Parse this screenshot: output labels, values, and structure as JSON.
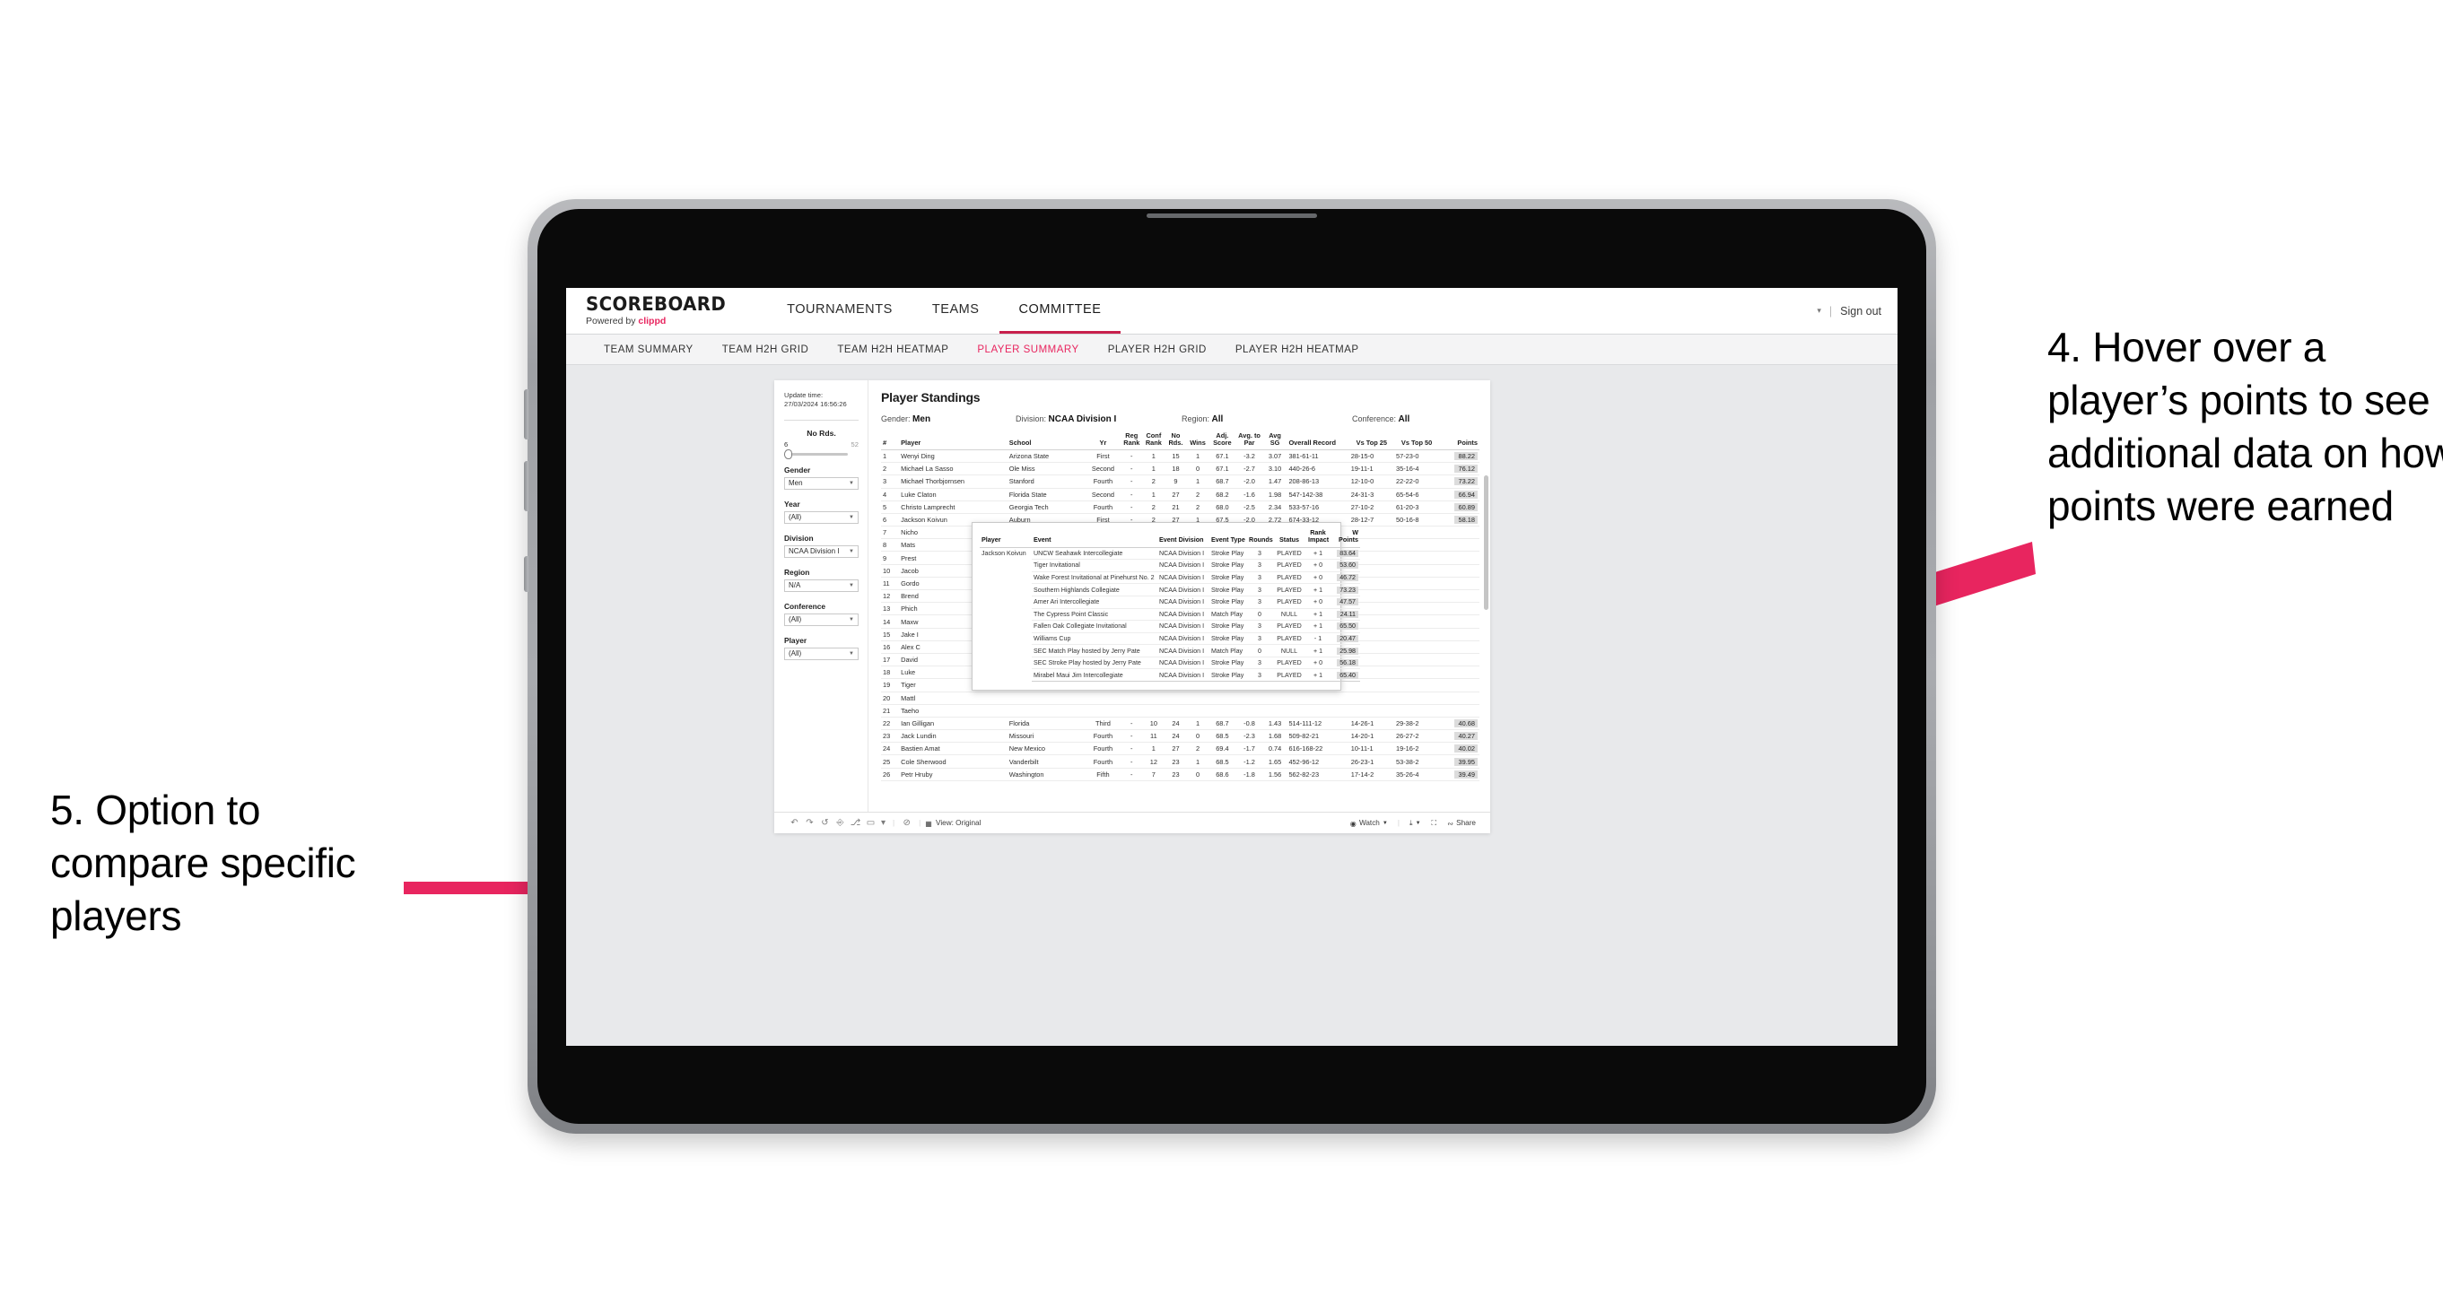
{
  "annotations": {
    "right": "4. Hover over a player’s points to see additional data on how points were earned",
    "left": "5. Option to compare specific players",
    "arrow_color": "#E8255F"
  },
  "app": {
    "brand": {
      "title": "SCOREBOARD",
      "sub_prefix": "Powered by ",
      "sub_brand": "clippd"
    },
    "top_nav": [
      {
        "label": "TOURNAMENTS",
        "active": false
      },
      {
        "label": "TEAMS",
        "active": false
      },
      {
        "label": "COMMITTEE",
        "active": true
      }
    ],
    "top_right": {
      "caret": "▾",
      "divider": "|",
      "sign_out": "Sign out"
    },
    "sub_nav": [
      {
        "label": "TEAM SUMMARY",
        "active": false
      },
      {
        "label": "TEAM H2H GRID",
        "active": false
      },
      {
        "label": "TEAM H2H HEATMAP",
        "active": false
      },
      {
        "label": "PLAYER SUMMARY",
        "active": true
      },
      {
        "label": "PLAYER H2H GRID",
        "active": false
      },
      {
        "label": "PLAYER H2H HEATMAP",
        "active": false
      }
    ]
  },
  "filters": {
    "update_label": "Update time:",
    "update_value": "27/03/2024 16:56:26",
    "slider": {
      "title": "No Rds.",
      "min": "6",
      "max": "52",
      "value": 6
    },
    "selects": [
      {
        "label": "Gender",
        "value": "Men"
      },
      {
        "label": "Year",
        "value": "(All)"
      },
      {
        "label": "Division",
        "value": "NCAA Division I"
      },
      {
        "label": "Region",
        "value": "N/A"
      },
      {
        "label": "Conference",
        "value": "(All)"
      },
      {
        "label": "Player",
        "value": "(All)"
      }
    ]
  },
  "viz": {
    "title": "Player Standings",
    "meta": [
      {
        "label": "Gender:",
        "value": "Men"
      },
      {
        "label": "Division:",
        "value": "NCAA Division I"
      },
      {
        "label": "Region:",
        "value": "All"
      },
      {
        "label": "Conference:",
        "value": "All"
      }
    ],
    "columns": [
      "#",
      "Player",
      "School",
      "Yr",
      "Reg Rank",
      "Conf Rank",
      "No Rds.",
      "Wins",
      "Adj. Score",
      "Avg. to Par",
      "Avg SG",
      "Overall Record",
      "Vs Top 25",
      "Vs Top 50",
      "Points"
    ],
    "rows": [
      [
        "1",
        "Wenyi Ding",
        "Arizona State",
        "First",
        "-",
        "1",
        "15",
        "1",
        "67.1",
        "-3.2",
        "3.07",
        "381-61-11",
        "28-15-0",
        "57-23-0",
        "88.22"
      ],
      [
        "2",
        "Michael La Sasso",
        "Ole Miss",
        "Second",
        "-",
        "1",
        "18",
        "0",
        "67.1",
        "-2.7",
        "3.10",
        "440-26-6",
        "19-11-1",
        "35-16-4",
        "76.12"
      ],
      [
        "3",
        "Michael Thorbjornsen",
        "Stanford",
        "Fourth",
        "-",
        "2",
        "9",
        "1",
        "68.7",
        "-2.0",
        "1.47",
        "208-86-13",
        "12-10-0",
        "22-22-0",
        "73.22"
      ],
      [
        "4",
        "Luke Claton",
        "Florida State",
        "Second",
        "-",
        "1",
        "27",
        "2",
        "68.2",
        "-1.6",
        "1.98",
        "547-142-38",
        "24-31-3",
        "65-54-6",
        "66.94"
      ],
      [
        "5",
        "Christo Lamprecht",
        "Georgia Tech",
        "Fourth",
        "-",
        "2",
        "21",
        "2",
        "68.0",
        "-2.5",
        "2.34",
        "533-57-16",
        "27-10-2",
        "61-20-3",
        "60.89"
      ],
      [
        "6",
        "Jackson Koivun",
        "Auburn",
        "First",
        "-",
        "2",
        "27",
        "1",
        "67.5",
        "-2.0",
        "2.72",
        "674-33-12",
        "28-12-7",
        "50-16-8",
        "58.18"
      ],
      [
        "7",
        "Nicho",
        "",
        "",
        "",
        "",
        "",
        "",
        "",
        "",
        "",
        "",
        "",
        "",
        ""
      ],
      [
        "8",
        "Mats",
        "",
        "",
        "",
        "",
        "",
        "",
        "",
        "",
        "",
        "",
        "",
        "",
        ""
      ],
      [
        "9",
        "Prest",
        "",
        "",
        "",
        "",
        "",
        "",
        "",
        "",
        "",
        "",
        "",
        "",
        ""
      ],
      [
        "10",
        "Jacob",
        "",
        "",
        "",
        "",
        "",
        "",
        "",
        "",
        "",
        "",
        "",
        "",
        ""
      ],
      [
        "11",
        "Gordo",
        "",
        "",
        "",
        "",
        "",
        "",
        "",
        "",
        "",
        "",
        "",
        "",
        ""
      ],
      [
        "12",
        "Brend",
        "",
        "",
        "",
        "",
        "",
        "",
        "",
        "",
        "",
        "",
        "",
        "",
        ""
      ],
      [
        "13",
        "Phich",
        "",
        "",
        "",
        "",
        "",
        "",
        "",
        "",
        "",
        "",
        "",
        "",
        ""
      ],
      [
        "14",
        "Maxw",
        "",
        "",
        "",
        "",
        "",
        "",
        "",
        "",
        "",
        "",
        "",
        "",
        ""
      ],
      [
        "15",
        "Jake I",
        "",
        "",
        "",
        "",
        "",
        "",
        "",
        "",
        "",
        "",
        "",
        "",
        ""
      ],
      [
        "16",
        "Alex C",
        "",
        "",
        "",
        "",
        "",
        "",
        "",
        "",
        "",
        "",
        "",
        "",
        ""
      ],
      [
        "17",
        "David",
        "",
        "",
        "",
        "",
        "",
        "",
        "",
        "",
        "",
        "",
        "",
        "",
        ""
      ],
      [
        "18",
        "Luke",
        "",
        "",
        "",
        "",
        "",
        "",
        "",
        "",
        "",
        "",
        "",
        "",
        ""
      ],
      [
        "19",
        "Tiger",
        "",
        "",
        "",
        "",
        "",
        "",
        "",
        "",
        "",
        "",
        "",
        "",
        ""
      ],
      [
        "20",
        "Mattl",
        "",
        "",
        "",
        "",
        "",
        "",
        "",
        "",
        "",
        "",
        "",
        "",
        ""
      ],
      [
        "21",
        "Taeho",
        "",
        "",
        "",
        "",
        "",
        "",
        "",
        "",
        "",
        "",
        "",
        "",
        ""
      ],
      [
        "22",
        "Ian Gilligan",
        "Florida",
        "Third",
        "-",
        "10",
        "24",
        "1",
        "68.7",
        "-0.8",
        "1.43",
        "514-111-12",
        "14-26-1",
        "29-38-2",
        "40.68"
      ],
      [
        "23",
        "Jack Lundin",
        "Missouri",
        "Fourth",
        "-",
        "11",
        "24",
        "0",
        "68.5",
        "-2.3",
        "1.68",
        "509-82-21",
        "14-20-1",
        "26-27-2",
        "40.27"
      ],
      [
        "24",
        "Bastien Amat",
        "New Mexico",
        "Fourth",
        "-",
        "1",
        "27",
        "2",
        "69.4",
        "-1.7",
        "0.74",
        "616-168-22",
        "10-11-1",
        "19-16-2",
        "40.02"
      ],
      [
        "25",
        "Cole Sherwood",
        "Vanderbilt",
        "Fourth",
        "-",
        "12",
        "23",
        "1",
        "68.5",
        "-1.2",
        "1.65",
        "452-96-12",
        "26-23-1",
        "53-38-2",
        "39.95"
      ],
      [
        "26",
        "Petr Hruby",
        "Washington",
        "Fifth",
        "-",
        "7",
        "23",
        "0",
        "68.6",
        "-1.8",
        "1.56",
        "562-82-23",
        "17-14-2",
        "35-26-4",
        "39.49"
      ]
    ]
  },
  "tooltip": {
    "columns": [
      "Player",
      "Event",
      "Event Division",
      "Event Type",
      "Rounds",
      "Status",
      "Rank Impact",
      "W Points"
    ],
    "player": "Jackson Koivun",
    "rows": [
      [
        "UNCW Seahawk Intercollegiate",
        "NCAA Division I",
        "Stroke Play",
        "3",
        "PLAYED",
        "+ 1",
        "83.64"
      ],
      [
        "Tiger Invitational",
        "NCAA Division I",
        "Stroke Play",
        "3",
        "PLAYED",
        "+ 0",
        "53.60"
      ],
      [
        "Wake Forest Invitational at Pinehurst No. 2",
        "NCAA Division I",
        "Stroke Play",
        "3",
        "PLAYED",
        "+ 0",
        "46.72"
      ],
      [
        "Southern Highlands Collegiate",
        "NCAA Division I",
        "Stroke Play",
        "3",
        "PLAYED",
        "+ 1",
        "73.23"
      ],
      [
        "Amer Ari Intercollegiate",
        "NCAA Division I",
        "Stroke Play",
        "3",
        "PLAYED",
        "+ 0",
        "47.57"
      ],
      [
        "The Cypress Point Classic",
        "NCAA Division I",
        "Match Play",
        "0",
        "NULL",
        "+ 1",
        "24.11"
      ],
      [
        "Fallen Oak Collegiate Invitational",
        "NCAA Division I",
        "Stroke Play",
        "3",
        "PLAYED",
        "+ 1",
        "65.50"
      ],
      [
        "Williams Cup",
        "NCAA Division I",
        "Stroke Play",
        "3",
        "PLAYED",
        "- 1",
        "20.47"
      ],
      [
        "SEC Match Play hosted by Jerry Pate",
        "NCAA Division I",
        "Match Play",
        "0",
        "NULL",
        "+ 1",
        "25.98"
      ],
      [
        "SEC Stroke Play hosted by Jerry Pate",
        "NCAA Division I",
        "Stroke Play",
        "3",
        "PLAYED",
        "+ 0",
        "56.18"
      ],
      [
        "Mirabel Maui Jim Intercollegiate",
        "NCAA Division I",
        "Stroke Play",
        "3",
        "PLAYED",
        "+ 1",
        "65.40"
      ]
    ]
  },
  "toolbar": {
    "undo": "↶",
    "redo": "↷",
    "revert": "↺",
    "refresh": "refresh-icon",
    "pause": "pause-icon",
    "view_mode": "▭",
    "caret": "▾",
    "alerts": "⊘",
    "view_label": "View: Original",
    "watch_label": "Watch",
    "download_label": "download-icon",
    "fullscreen_label": "fullscreen-icon",
    "share_label": "Share"
  }
}
